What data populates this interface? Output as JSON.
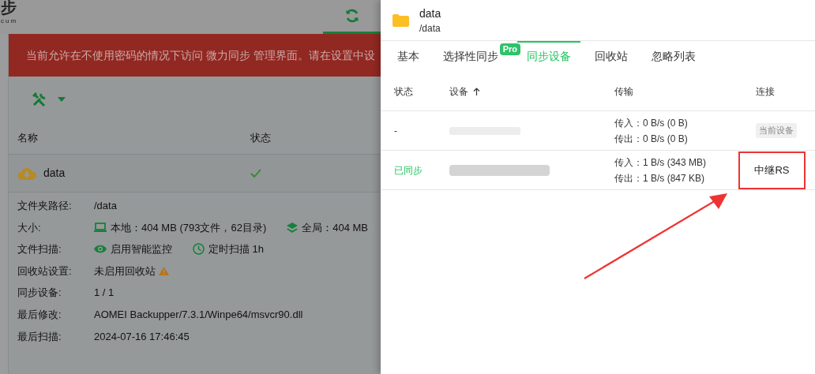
{
  "app": {
    "logo": "步",
    "logo_sub": "cum"
  },
  "banner": {
    "text": "当前允许在不使用密码的情况下访问 微力同步 管理界面。请在设置中设"
  },
  "folder_table": {
    "columns": [
      {
        "label": "名称"
      },
      {
        "label": "状态"
      }
    ],
    "rows": [
      {
        "name": "data",
        "synced": true
      }
    ]
  },
  "details": [
    {
      "label": "文件夹路径:",
      "parts": [
        {
          "kind": "text",
          "text": "/data"
        }
      ]
    },
    {
      "label": "大小:",
      "parts": [
        {
          "kind": "local",
          "text": "本地：404 MB (793文件，62目录)"
        },
        {
          "kind": "global",
          "text": "全局：404 MB"
        }
      ]
    },
    {
      "label": "文件扫描:",
      "parts": [
        {
          "kind": "monitor",
          "text": "启用智能监控"
        },
        {
          "kind": "schedule",
          "text": "定时扫描 1h"
        }
      ]
    },
    {
      "label": "回收站设置:",
      "parts": [
        {
          "kind": "text",
          "text": "未启用回收站"
        },
        {
          "kind": "warning"
        }
      ]
    },
    {
      "label": "同步设备:",
      "parts": [
        {
          "kind": "text",
          "text": "1 / 1"
        }
      ]
    },
    {
      "label": "最后修改:",
      "parts": [
        {
          "kind": "text",
          "text": "AOMEI Backupper/7.3.1/Winpe64/msvcr90.dll"
        }
      ]
    },
    {
      "label": "最后扫描:",
      "parts": [
        {
          "kind": "text",
          "text": "2024-07-16 17:46:45"
        }
      ]
    }
  ],
  "drawer": {
    "title": "data",
    "path": "/data",
    "tabs": [
      {
        "label": "基本",
        "selected": false
      },
      {
        "label": "选择性同步",
        "selected": false,
        "badge": "Pro"
      },
      {
        "label": "同步设备",
        "selected": true
      },
      {
        "label": "回收站",
        "selected": false
      },
      {
        "label": "忽略列表",
        "selected": false
      }
    ],
    "columns": [
      {
        "label": "状态"
      },
      {
        "label": "设备",
        "sorted": true
      },
      {
        "label": "传输"
      },
      {
        "label": "连接"
      }
    ],
    "rows": [
      {
        "status": "-",
        "synced": false,
        "transfer_in": "传入：0 B/s (0 B)",
        "transfer_out": "传出：0 B/s (0 B)",
        "connection": "当前设备",
        "kind": "current",
        "highlighted": false
      },
      {
        "status": "已同步",
        "synced": true,
        "transfer_in": "传入：1 B/s (343 MB)",
        "transfer_out": "传出：1 B/s (847 KB)",
        "connection": "中继RS",
        "kind": "relay",
        "highlighted": true
      }
    ]
  }
}
